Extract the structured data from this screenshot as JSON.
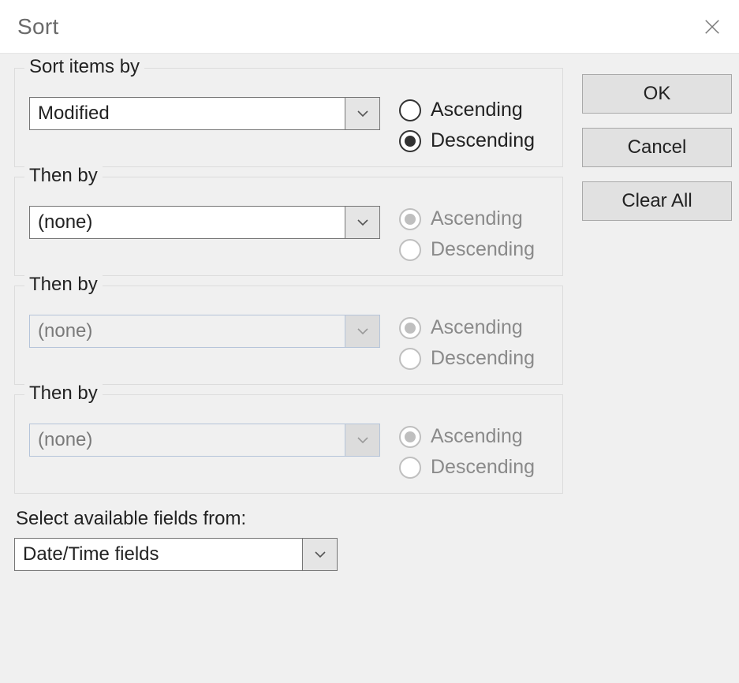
{
  "title": "Sort",
  "buttons": {
    "ok": "OK",
    "cancel": "Cancel",
    "clear_all": "Clear All"
  },
  "labels": {
    "ascending": "Ascending",
    "descending": "Descending",
    "select_fields": "Select available fields from:"
  },
  "levels": [
    {
      "legend": "Sort items by",
      "value": "Modified",
      "direction": "descending",
      "enabled": true
    },
    {
      "legend": "Then by",
      "value": "(none)",
      "direction": "ascending",
      "enabled": true
    },
    {
      "legend": "Then by",
      "value": "(none)",
      "direction": "ascending",
      "enabled": false
    },
    {
      "legend": "Then by",
      "value": "(none)",
      "direction": "ascending",
      "enabled": false
    }
  ],
  "fields_from": "Date/Time fields"
}
